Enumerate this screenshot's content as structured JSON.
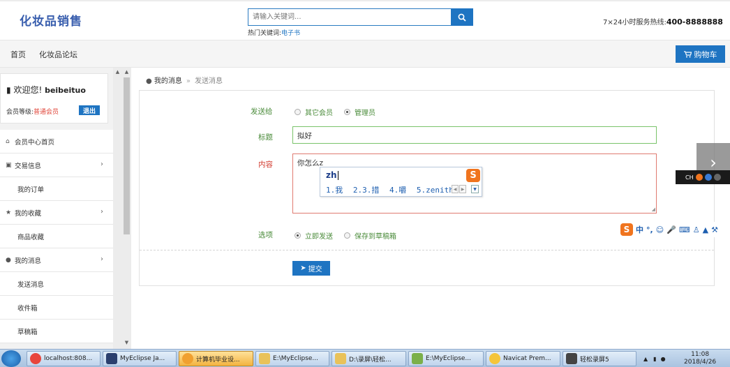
{
  "header": {
    "logo": "化妆品销售",
    "search_placeholder": "请输入关键词...",
    "hot_label": "热门关键词:",
    "hot_keyword": "电子书",
    "hotline_label": "7×24小时服务热线:",
    "hotline_number": "400-8888888"
  },
  "nav": {
    "items": [
      "首页",
      "化妆品论坛"
    ],
    "cart_label": "购物车"
  },
  "sidebar": {
    "welcome": "欢迎您!",
    "username": "beibeituo",
    "level_label": "会员等级:",
    "level_value": "普通会员",
    "logout_label": "退出",
    "menu": [
      {
        "label": "会员中心首页",
        "type": "top",
        "icon": "home-icon"
      },
      {
        "label": "交易信息",
        "type": "top",
        "icon": "briefcase-icon",
        "arrow": "›"
      },
      {
        "label": "我的订单",
        "type": "sub"
      },
      {
        "label": "我的收藏",
        "type": "top",
        "icon": "star-icon",
        "arrow": "›"
      },
      {
        "label": "商品收藏",
        "type": "sub"
      },
      {
        "label": "我的消息",
        "type": "top",
        "icon": "comment-icon",
        "arrow": "›"
      },
      {
        "label": "发送消息",
        "type": "sub"
      },
      {
        "label": "收件箱",
        "type": "sub"
      },
      {
        "label": "草稿箱",
        "type": "sub"
      }
    ]
  },
  "breadcrumb": {
    "parent": "我的消息",
    "separator": "»",
    "current": "发送消息"
  },
  "form": {
    "send_to_label": "发送给",
    "send_to_options": [
      "其它会员",
      "管理员"
    ],
    "send_to_selected": "管理员",
    "title_label": "标题",
    "title_value": "拟好",
    "content_label": "内容",
    "content_value": "你怎么z",
    "option_label": "选项",
    "option_choices": [
      "立即发送",
      "保存到草稿箱"
    ],
    "option_selected": "立即发送",
    "submit_label": "提交"
  },
  "ime": {
    "composition": "zh",
    "candidates": [
      "1.我",
      "2.3.措",
      "4.嚼",
      "5.zenith"
    ],
    "logo": "S",
    "toolbar_mode": "中",
    "toolbar_punct": "°,"
  },
  "mini_bar": {
    "label": "CH"
  },
  "taskbar": {
    "items": [
      {
        "label": "localhost:808...",
        "color": "#e8453c"
      },
      {
        "label": "MyEclipse Ja...",
        "color": "#2b3f6e"
      },
      {
        "label": "计算机毕业设...",
        "color": "#f0a030"
      },
      {
        "label": "E:\\MyEclipse...",
        "color": "#e9c25a"
      },
      {
        "label": "D:\\录屏\\轻松...",
        "color": "#e9c25a"
      },
      {
        "label": "E:\\MyEclipse...",
        "color": "#7bb04a"
      },
      {
        "label": "Navicat Prem...",
        "color": "#f5c53a"
      },
      {
        "label": "轻松录屏5",
        "color": "#444444"
      }
    ],
    "active_index": 2,
    "time": "11:08",
    "date": "2018/4/26"
  },
  "colors": {
    "brand_blue": "#1e74c2",
    "label_green": "#4a8b3a",
    "error_red": "#d23a2e",
    "logo_blue": "#3a5fae"
  }
}
